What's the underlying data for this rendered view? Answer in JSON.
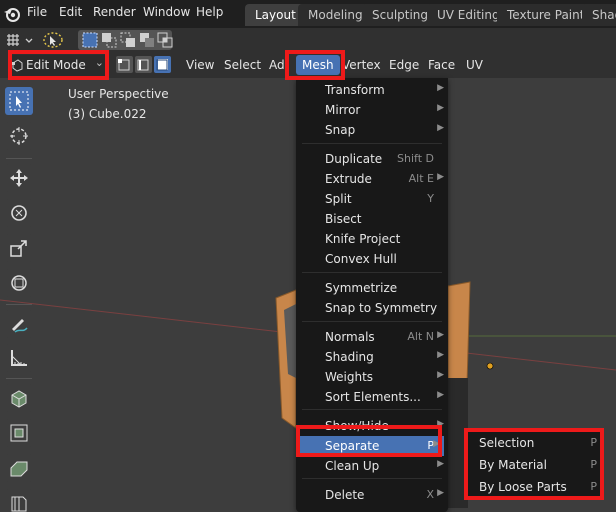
{
  "topbar": {
    "menus": [
      "File",
      "Edit",
      "Render",
      "Window",
      "Help"
    ],
    "workspaces": [
      "Layout",
      "Modeling",
      "Sculpting",
      "UV Editing",
      "Texture Paint",
      "Shad"
    ],
    "active_workspace": "Layout"
  },
  "header": {
    "mode": "Edit Mode",
    "menus": [
      "View",
      "Select",
      "Add",
      "Mesh",
      "Vertex",
      "Edge",
      "Face",
      "UV"
    ],
    "active_menu": "Mesh"
  },
  "viewport": {
    "perspective": "User Perspective",
    "object": "(3) Cube.022"
  },
  "mesh_menu": {
    "items": [
      {
        "label": "Transform",
        "shortcut": "",
        "submenu": true
      },
      {
        "label": "Mirror",
        "shortcut": "",
        "submenu": true
      },
      {
        "label": "Snap",
        "shortcut": "",
        "submenu": true
      },
      {
        "label": "Duplicate",
        "shortcut": "Shift D",
        "submenu": false
      },
      {
        "label": "Extrude",
        "shortcut": "Alt E",
        "submenu": true
      },
      {
        "label": "Split",
        "shortcut": "Y",
        "submenu": false
      },
      {
        "label": "Bisect",
        "shortcut": "",
        "submenu": false
      },
      {
        "label": "Knife Project",
        "shortcut": "",
        "submenu": false
      },
      {
        "label": "Convex Hull",
        "shortcut": "",
        "submenu": false
      },
      {
        "label": "Symmetrize",
        "shortcut": "",
        "submenu": false
      },
      {
        "label": "Snap to Symmetry",
        "shortcut": "",
        "submenu": false
      },
      {
        "label": "Normals",
        "shortcut": "Alt N",
        "submenu": true
      },
      {
        "label": "Shading",
        "shortcut": "",
        "submenu": true
      },
      {
        "label": "Weights",
        "shortcut": "",
        "submenu": true
      },
      {
        "label": "Sort Elements...",
        "shortcut": "",
        "submenu": true
      },
      {
        "label": "Show/Hide",
        "shortcut": "",
        "submenu": true
      },
      {
        "label": "Separate",
        "shortcut": "P",
        "submenu": true
      },
      {
        "label": "Clean Up",
        "shortcut": "",
        "submenu": true
      },
      {
        "label": "Delete",
        "shortcut": "X",
        "submenu": true
      }
    ]
  },
  "separate_submenu": {
    "items": [
      {
        "label": "Selection",
        "shortcut": "P"
      },
      {
        "label": "By Material",
        "shortcut": "P"
      },
      {
        "label": "By Loose Parts",
        "shortcut": "P"
      }
    ]
  },
  "colors": {
    "accent": "#4772b3",
    "annotation": "#ee1a1a",
    "object_orange": "#c8864a"
  }
}
